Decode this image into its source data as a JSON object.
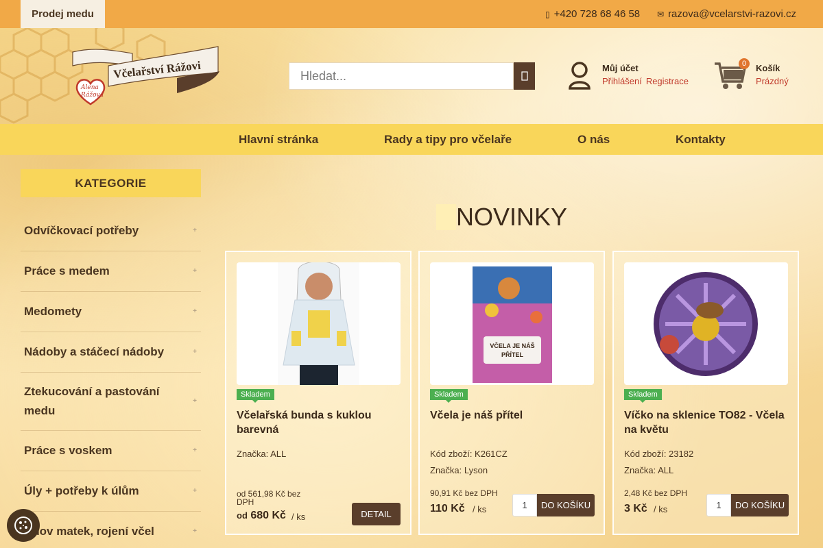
{
  "topbar": {
    "sell_label": "Prodej medu",
    "phone": "+420 728 68 46 58",
    "email": "razova@vcelarstvi-razovi.cz"
  },
  "header": {
    "logo_text": "Včelařství Rážovi",
    "logo_heart_text": "Alena Rážová",
    "search_placeholder": "Hledat...",
    "account": {
      "title": "Můj účet",
      "login": "Přihlášení",
      "register": "Registrace"
    },
    "cart": {
      "count": "0",
      "title": "Košík",
      "status": "Prázdný"
    }
  },
  "nav": [
    "Hlavní stránka",
    "Rady a tipy pro včelaře",
    "O nás",
    "Kontakty"
  ],
  "sidebar": {
    "heading": "KATEGORIE",
    "items": [
      "Odvíčkovací potřeby",
      "Práce s medem",
      "Medomety",
      "Nádoby a stáčecí nádoby",
      "Ztekucování a pastování medu",
      "Práce s voskem",
      "Úly + potřeby k úlům",
      "Chov matek, rojení včel"
    ],
    "expand_symbol": "+"
  },
  "main": {
    "section_title": "NOVINKY",
    "products": [
      {
        "stock": "Skladem",
        "name": "Včelařská bunda s kuklou barevná",
        "code": "",
        "brand": "Značka: ALL",
        "price_without_vat": "od 561,98 Kč bez DPH",
        "price_prefix": "od",
        "price": "680 Kč",
        "unit": "/ ks",
        "button": "DETAIL"
      },
      {
        "stock": "Skladem",
        "name": "Včela je náš přítel",
        "code": "Kód zboží: K261CZ",
        "brand": "Značka: Lyson",
        "price_without_vat": "90,91 Kč bez DPH",
        "price": "110 Kč",
        "unit": "/ ks",
        "qty": "1",
        "button": "DO KOŠÍKU",
        "book_title": "VČELA JE NÁŠ PŘÍTEL"
      },
      {
        "stock": "Skladem",
        "name": "Víčko na sklenice TO82 - Včela na květu",
        "code": "Kód zboží: 23182",
        "brand": "Značka: ALL",
        "price_without_vat": "2,48 Kč bez DPH",
        "price": "3 Kč",
        "unit": "/ ks",
        "qty": "1",
        "button": "DO KOŠÍKU"
      }
    ]
  },
  "colors": {
    "topbar": "#f1a947",
    "nav": "#f9d65a",
    "button": "#5a3e2b",
    "stock_badge": "#4caf50",
    "link": "#c0392b"
  }
}
